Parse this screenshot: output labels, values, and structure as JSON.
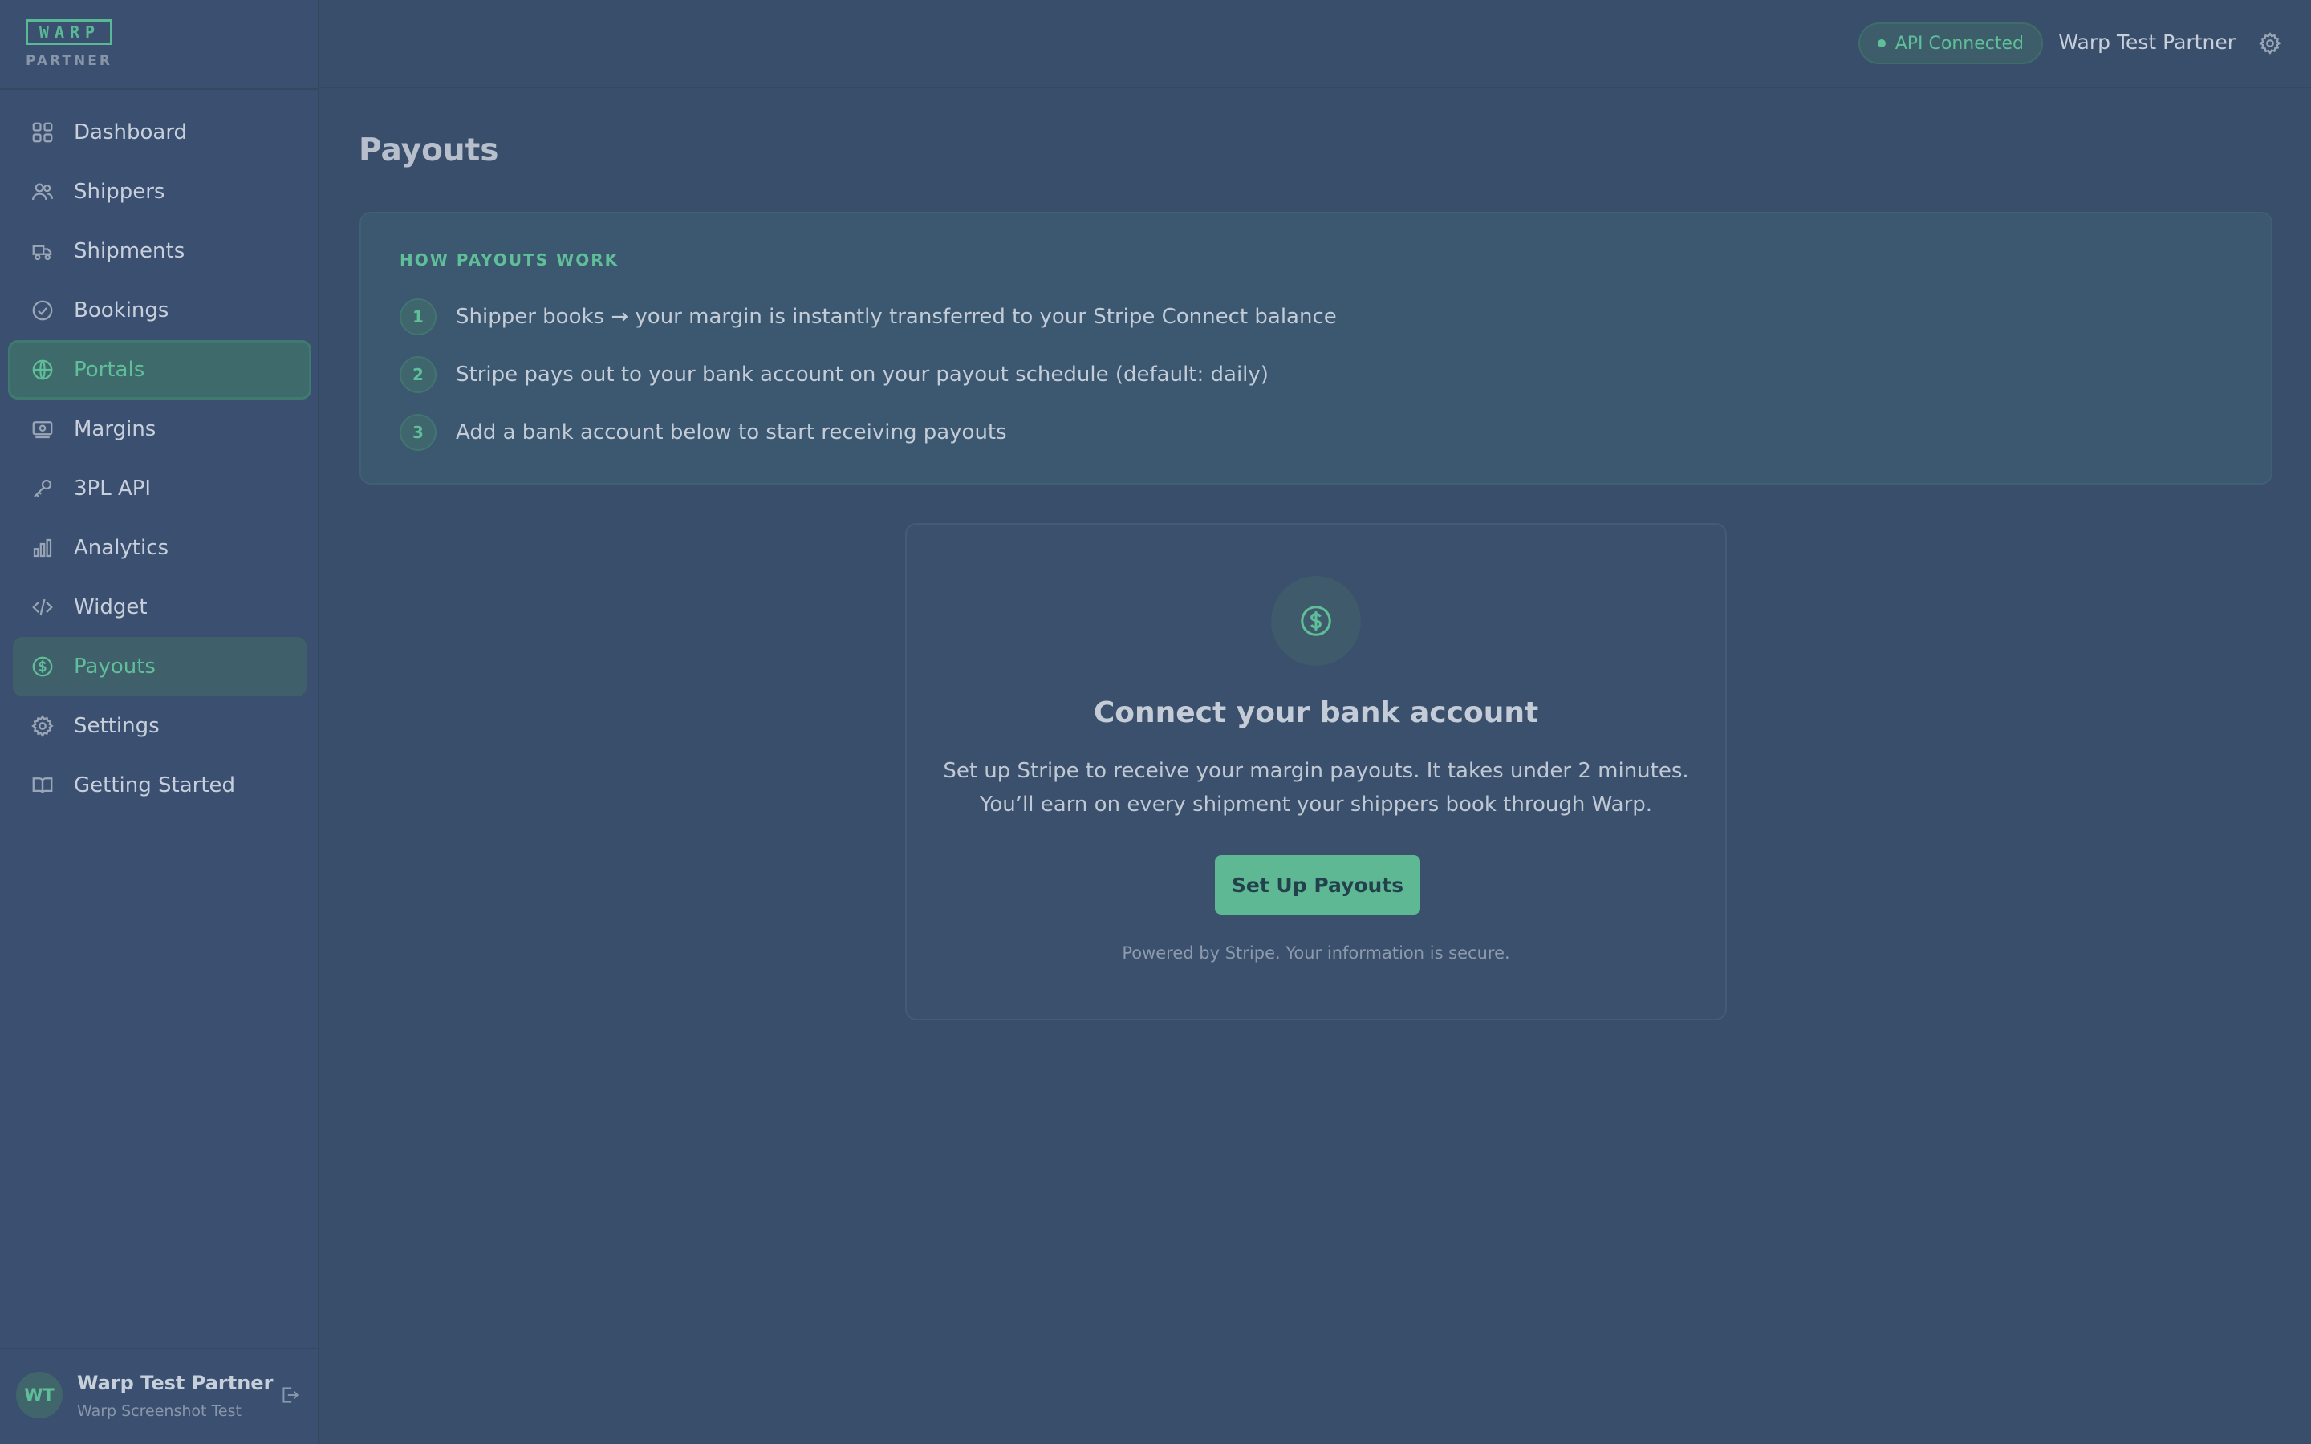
{
  "brand": {
    "logo_text": "WARP",
    "subtitle": "PARTNER"
  },
  "sidebar": {
    "items": [
      {
        "label": "Dashboard",
        "icon": "grid-icon"
      },
      {
        "label": "Shippers",
        "icon": "users-icon"
      },
      {
        "label": "Shipments",
        "icon": "truck-icon"
      },
      {
        "label": "Bookings",
        "icon": "check-circle-icon"
      },
      {
        "label": "Portals",
        "icon": "globe-icon"
      },
      {
        "label": "Margins",
        "icon": "banknote-icon"
      },
      {
        "label": "3PL API",
        "icon": "key-icon"
      },
      {
        "label": "Analytics",
        "icon": "bar-chart-icon"
      },
      {
        "label": "Widget",
        "icon": "code-icon"
      },
      {
        "label": "Payouts",
        "icon": "dollar-circle-icon"
      },
      {
        "label": "Settings",
        "icon": "gear-icon"
      },
      {
        "label": "Getting Started",
        "icon": "book-icon"
      }
    ],
    "active_item": "Payouts",
    "hover_item": "Portals"
  },
  "user": {
    "initials": "WT",
    "name": "Warp Test Partner",
    "org": "Warp Screenshot Test"
  },
  "header": {
    "api_status": "API Connected",
    "user_name": "Warp Test Partner"
  },
  "page": {
    "title": "Payouts"
  },
  "how_payouts": {
    "title": "HOW PAYOUTS WORK",
    "steps": [
      {
        "num": "1",
        "text": "Shipper books → your margin is instantly transferred to your Stripe Connect balance"
      },
      {
        "num": "2",
        "text": "Stripe pays out to your bank account on your payout schedule (default: daily)"
      },
      {
        "num": "3",
        "text": "Add a bank account below to start receiving payouts"
      }
    ]
  },
  "connect": {
    "title": "Connect your bank account",
    "desc_line1": "Set up Stripe to receive your margin payouts. It takes under 2 minutes.",
    "desc_line2": "You’ll earn on every shipment your shippers book through Warp.",
    "button": "Set Up Payouts",
    "note": "Powered by Stripe. Your information is secure."
  },
  "colors": {
    "background": "#394e6b",
    "accent": "#5fbf98",
    "text": "#c3ccd7"
  }
}
